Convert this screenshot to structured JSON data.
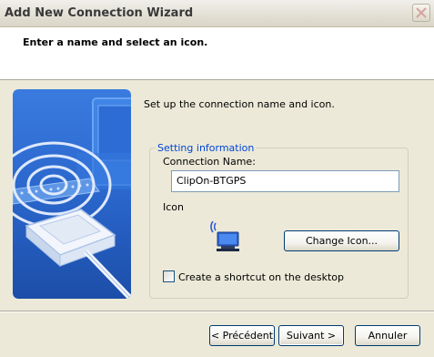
{
  "window": {
    "title": "Add New Connection Wizard"
  },
  "header": {
    "title": "Enter a name and select an icon."
  },
  "main": {
    "intro": "Set up the connection name and icon.",
    "group": {
      "legend": "Setting information",
      "connection_name_label": "Connection Name:",
      "connection_name_value": "ClipOn-BTGPS",
      "icon_label": "Icon",
      "icon_name": "network-computer-icon",
      "change_icon_button": "Change Icon...",
      "shortcut_checkbox_label": "Create a shortcut on the desktop",
      "shortcut_checked": false
    }
  },
  "footer": {
    "back_button": "< Précédent",
    "next_button": "Suivant >",
    "cancel_button": "Annuler"
  },
  "colors": {
    "accent": "#0046D5",
    "window_bg": "#ECE9D8"
  }
}
